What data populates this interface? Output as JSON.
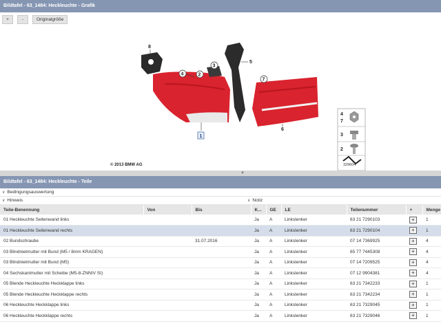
{
  "window": {
    "title": "Bildtafel - 63_1484: Heckleuchte - Grafik"
  },
  "toolbar": {
    "zoom_in": "+",
    "zoom_out": "-",
    "original": "Originalgröße"
  },
  "graphic": {
    "copyright": "© 2013 BMW AG",
    "image_number": "329604",
    "callouts": [
      "8",
      "4",
      "2",
      "3",
      "5",
      "7",
      "6",
      "1"
    ],
    "key_items": [
      "4",
      "7",
      "3",
      "2"
    ]
  },
  "parts_panel": {
    "title": "Bildtafel - 63_1484: Heckleuchte - Teile"
  },
  "filters": {
    "condition": "Bedingungsauswertung",
    "hint": "Hinweis",
    "note": "Notiz"
  },
  "table": {
    "headers": [
      "Teile-Benennung",
      "Von",
      "Bis",
      "K...",
      "GE",
      "LE",
      "Teilenummer",
      "+",
      "Menge"
    ],
    "rows": [
      {
        "name": "01 Heckleuchte Seitenwand links",
        "von": "",
        "bis": "",
        "k": "Ja",
        "ge": "A",
        "le": "Linkslenker",
        "part": "63 21 7290103",
        "qty": "1",
        "selected": false
      },
      {
        "name": "01 Heckleuchte Seitenwand rechts",
        "von": "",
        "bis": "",
        "k": "Ja",
        "ge": "A",
        "le": "Linkslenker",
        "part": "63 21 7290104",
        "qty": "1",
        "selected": true
      },
      {
        "name": "02 Bundschraube",
        "von": "",
        "bis": "31.07.2016",
        "k": "Ja",
        "ge": "A",
        "le": "Linkslenker",
        "part": "07 14 7369925",
        "qty": "4",
        "selected": false
      },
      {
        "name": "03 Blindnietmutter mit Bund (M5 / 8mm KRAGEN)",
        "von": "",
        "bis": "",
        "k": "Ja",
        "ge": "A",
        "le": "Linkslenker",
        "part": "65 77 7445308",
        "qty": "4",
        "selected": false
      },
      {
        "name": "03 Blindnietmutter mit Bund (M5)",
        "von": "",
        "bis": "",
        "k": "Ja",
        "ge": "A",
        "le": "Linkslenker",
        "part": "07 14 7209525",
        "qty": "4",
        "selected": false
      },
      {
        "name": "04 Sechskantmutter mit Scheibe (M5-8-ZNNIV SI)",
        "von": "",
        "bis": "",
        "k": "Ja",
        "ge": "A",
        "le": "Linkslenker",
        "part": "07 12 9904381",
        "qty": "4",
        "selected": false
      },
      {
        "name": "05 Blende Heckleuchte Heckklappe links",
        "von": "",
        "bis": "",
        "k": "Ja",
        "ge": "A",
        "le": "Linkslenker",
        "part": "63 21 7342233",
        "qty": "1",
        "selected": false
      },
      {
        "name": "05 Blende Heckleuchte Heckklappe rechts",
        "von": "",
        "bis": "",
        "k": "Ja",
        "ge": "A",
        "le": "Linkslenker",
        "part": "63 21 7342234",
        "qty": "1",
        "selected": false
      },
      {
        "name": "06 Heckleuchte Heckklappe links",
        "von": "",
        "bis": "",
        "k": "Ja",
        "ge": "A",
        "le": "Linkslenker",
        "part": "63 21 7329045",
        "qty": "1",
        "selected": false
      },
      {
        "name": "06 Heckleuchte Heckklappe rechts",
        "von": "",
        "bis": "",
        "k": "Ja",
        "ge": "A",
        "le": "Linkslenker",
        "part": "63 21 7329046",
        "qty": "1",
        "selected": false
      }
    ]
  },
  "colors": {
    "titlebar": "#8596b3",
    "selected_row": "#d4dde9",
    "lamp_red": "#d9232e"
  }
}
